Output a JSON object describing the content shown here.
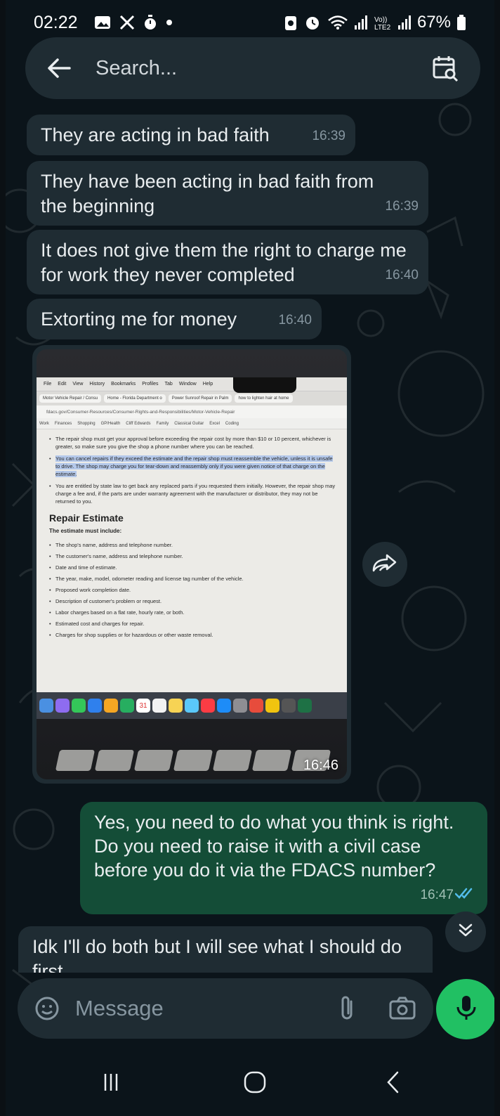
{
  "status_bar": {
    "time": "02:22",
    "battery": "67%",
    "left_icons": [
      "gallery-icon",
      "x-icon",
      "timer-icon",
      "dot-icon"
    ],
    "right_icons": [
      "battery-saver-icon",
      "alarm-icon",
      "wifi-icon",
      "signal-icon",
      "volte-icon",
      "signal-icon",
      "battery-icon"
    ]
  },
  "search": {
    "placeholder": "Search..."
  },
  "messages": [
    {
      "text": "They are acting in bad faith",
      "time": "16:39",
      "direction": "incoming"
    },
    {
      "text": "They have been acting in bad faith from the beginning",
      "time": "16:39",
      "direction": "incoming"
    },
    {
      "text": "It does not give them the right to charge me for work they never completed",
      "time": "16:40",
      "direction": "incoming"
    },
    {
      "text": "Extorting me for money",
      "time": "16:40",
      "direction": "incoming"
    },
    {
      "text": "Yes, you need to do what you think is right. Do you need to raise it with a civil case before you do it via the FDACS number?",
      "time": "16:47",
      "direction": "outgoing",
      "status": "read"
    },
    {
      "text": "Idk I'll do both but I will see what I should do first",
      "time": "",
      "direction": "incoming"
    }
  ],
  "image_message": {
    "time": "16:46",
    "photo": {
      "menubar": [
        "File",
        "Edit",
        "View",
        "History",
        "Bookmarks",
        "Profiles",
        "Tab",
        "Window",
        "Help"
      ],
      "tabs": [
        "Motor Vehicle Repair / Consu",
        "Home - Florida Department o",
        "Power Sunroof Repair in Palm",
        "how to lighten hair at home"
      ],
      "url": "fdacs.gov/Consumer-Resources/Consumer-Rights-and-Responsibilities/Motor-Vehicle-Repair",
      "bookmarks": [
        "Work",
        "Finances",
        "Shopping",
        "GP/Health",
        "Cliff Edwards",
        "Family",
        "Classical Guitar",
        "Excel",
        "Coding"
      ],
      "bullet1": "The repair shop must get your approval before exceeding the repair cost by more than $10 or 10 percent, whichever is greater, so make sure you give the shop a phone number where you can be reached.",
      "bullet2": "You can cancel repairs if they exceed the estimate and the repair shop must reassemble the vehicle, unless it is unsafe to drive. The shop may charge you for tear-down and reassembly only if you were given notice of that charge on the estimate.",
      "bullet3": "You are entitled by state law to get back any replaced parts if you requested them initially. However, the repair shop may charge a fee and, if the parts are under warranty agreement with the manufacturer or distributor, they may not be returned to you.",
      "heading": "Repair Estimate",
      "subheading": "The estimate must include:",
      "estimate_items": [
        "The shop's name, address and telephone number.",
        "The customer's name, address and telephone number.",
        "Date and time of estimate.",
        "The year, make, model, odometer reading and license tag number of the vehicle.",
        "Proposed work completion date.",
        "Description of customer's problem or request.",
        "Labor charges based on a flat rate, hourly rate, or both.",
        "Estimated cost and charges for repair.",
        "Charges for shop supplies or for hazardous or other waste removal."
      ],
      "dock_date": "31"
    }
  },
  "composer": {
    "placeholder": "Message"
  },
  "colors": {
    "background": "#0b141a",
    "incoming_bubble": "#1f2c33",
    "outgoing_bubble": "#144d37",
    "accent_green": "#21c063",
    "read_ticks": "#53bdeb"
  }
}
